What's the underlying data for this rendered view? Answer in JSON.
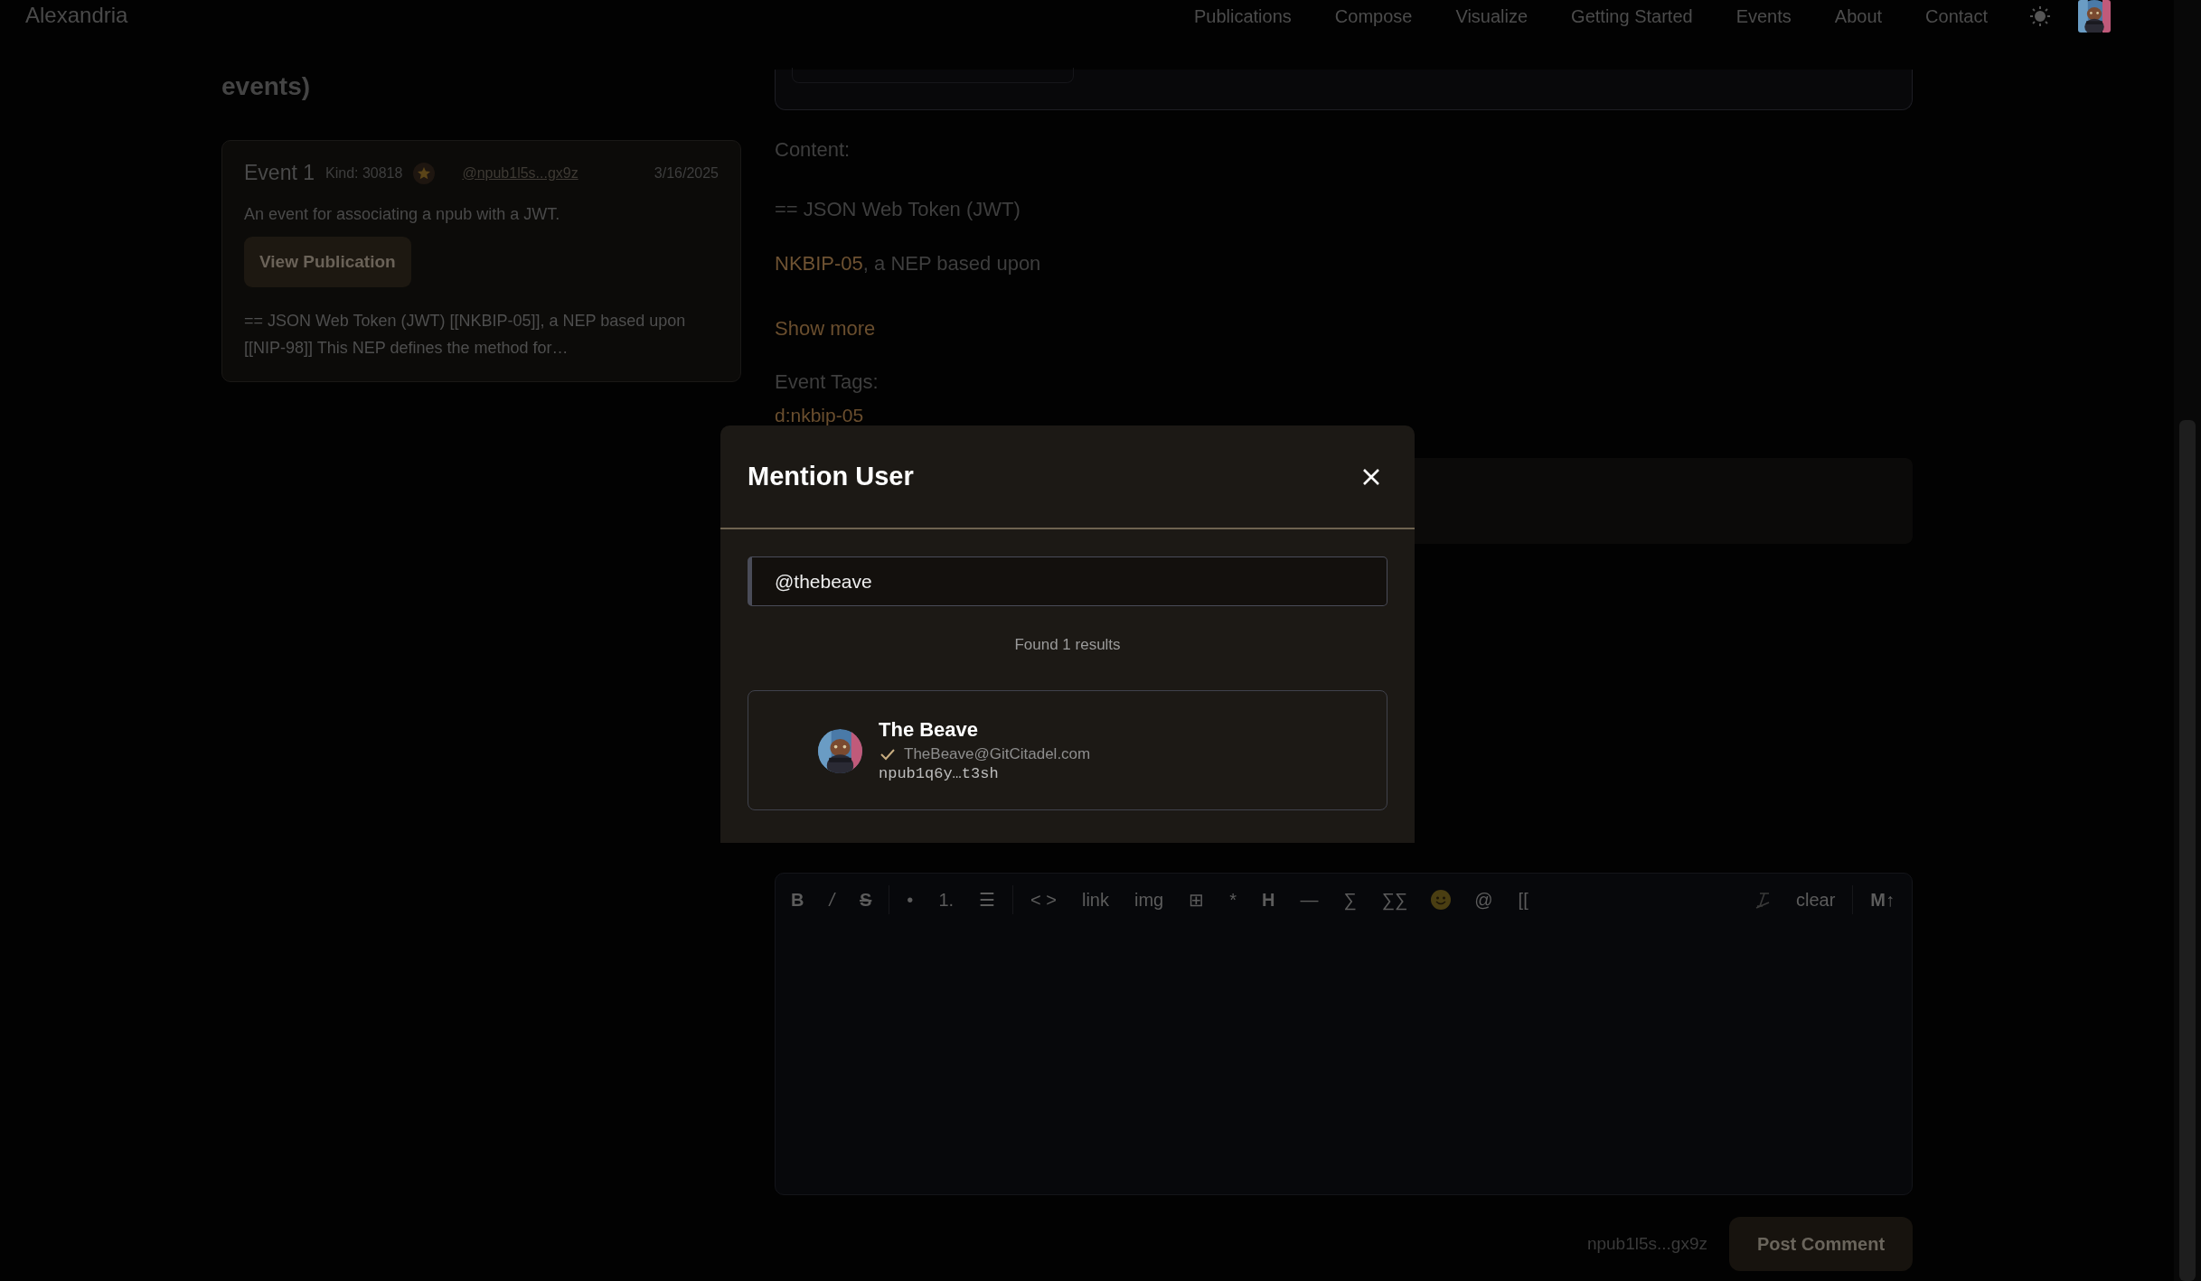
{
  "header": {
    "brand": "Alexandria",
    "nav": [
      {
        "label": "Publications"
      },
      {
        "label": "Compose"
      },
      {
        "label": "Visualize"
      },
      {
        "label": "Getting Started"
      },
      {
        "label": "Events"
      },
      {
        "label": "About"
      },
      {
        "label": "Contact"
      }
    ]
  },
  "sidebar": {
    "heading": "events)",
    "events": [
      {
        "title": "Event 1",
        "kind_label": "Kind: 30818",
        "author": "@npub1l5s...gx9z",
        "date": "3/16/2025",
        "summary": "An event for associating a npub with a JWT.",
        "button": "View Publication",
        "excerpt": "== JSON Web Token (JWT) [[NKBIP-05]], a NEP based upon [[NIP-98]] This NEP defines the method for…"
      }
    ]
  },
  "detail": {
    "content_label": "Content:",
    "heading": "== JSON Web Token (JWT)",
    "link": "NKBIP-05",
    "paragraph_rest": ", a NEP based upon",
    "show_more": "Show more",
    "tags_label": "Event Tags:",
    "tags": [
      "d:nkbip-05"
    ]
  },
  "editor": {
    "toolbar": [
      {
        "kind": "bold",
        "label": "B"
      },
      {
        "kind": "italic",
        "label": "/"
      },
      {
        "kind": "strike",
        "label": "S"
      },
      {
        "kind": "sep"
      },
      {
        "kind": "text",
        "label": "•"
      },
      {
        "kind": "text",
        "label": "1."
      },
      {
        "kind": "text",
        "label": "☰"
      },
      {
        "kind": "sep"
      },
      {
        "kind": "text",
        "label": "< >"
      },
      {
        "kind": "text",
        "label": "link"
      },
      {
        "kind": "text",
        "label": "img"
      },
      {
        "kind": "text",
        "label": "⊞"
      },
      {
        "kind": "text",
        "label": "*"
      },
      {
        "kind": "bold",
        "label": "H"
      },
      {
        "kind": "text",
        "label": "—"
      },
      {
        "kind": "text",
        "label": "∑"
      },
      {
        "kind": "text",
        "label": "∑∑"
      },
      {
        "kind": "emoji"
      },
      {
        "kind": "text",
        "label": "@"
      },
      {
        "kind": "text",
        "label": "[["
      },
      {
        "kind": "spacer"
      },
      {
        "kind": "clear-icon"
      },
      {
        "kind": "text",
        "label": "clear"
      },
      {
        "kind": "sep"
      },
      {
        "kind": "bold",
        "label": "M↑"
      }
    ],
    "author": "npub1l5s...gx9z",
    "submit": "Post Comment"
  },
  "modal": {
    "title": "Mention User",
    "search": {
      "value": "@thebeave"
    },
    "status": "Found 1 results",
    "results": [
      {
        "name": "The Beave",
        "verified": true,
        "nip05": "TheBeave@GitCitadel.com",
        "npub": "npub1q6y…t3sh"
      }
    ]
  }
}
